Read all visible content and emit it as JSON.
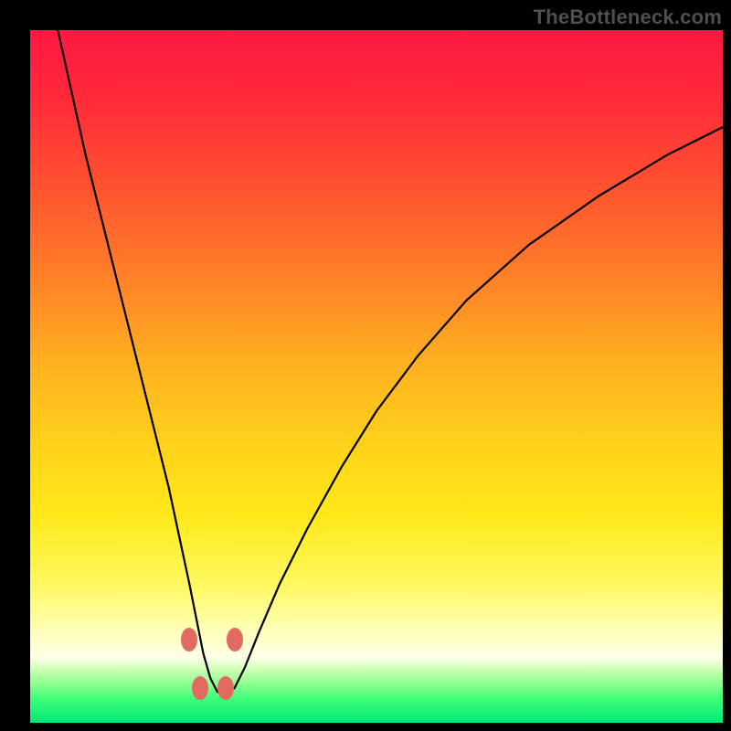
{
  "watermark": "TheBottleneck.com",
  "colors": {
    "page_bg": "#000000",
    "watermark": "#4f4f4f",
    "curve": "#000000",
    "dot": "#e26a60",
    "gradient_stops": [
      {
        "offset": 0.0,
        "color": "#ff1840"
      },
      {
        "offset": 0.1,
        "color": "#ff2a3a"
      },
      {
        "offset": 0.22,
        "color": "#ff5030"
      },
      {
        "offset": 0.35,
        "color": "#ff7e28"
      },
      {
        "offset": 0.48,
        "color": "#ffb020"
      },
      {
        "offset": 0.6,
        "color": "#ffd21a"
      },
      {
        "offset": 0.7,
        "color": "#ffe81a"
      },
      {
        "offset": 0.8,
        "color": "#fff860"
      },
      {
        "offset": 0.86,
        "color": "#ffffb0"
      },
      {
        "offset": 0.905,
        "color": "#ffffe8"
      },
      {
        "offset": 0.925,
        "color": "#c8ffb0"
      },
      {
        "offset": 0.945,
        "color": "#8aff90"
      },
      {
        "offset": 0.965,
        "color": "#40ff78"
      },
      {
        "offset": 1.0,
        "color": "#00e878"
      }
    ]
  },
  "chart_data": {
    "type": "line",
    "title": "",
    "xlabel": "",
    "ylabel": "",
    "xlim": [
      0,
      100
    ],
    "ylim": [
      0,
      100
    ],
    "grid": false,
    "legend": false,
    "series": [
      {
        "name": "bottleneck-curve",
        "x": [
          4,
          6,
          8,
          10,
          12,
          14,
          16,
          18,
          20,
          21.5,
          23,
          24.2,
          25,
          26,
          27,
          28,
          29.5,
          31,
          33,
          36,
          40,
          45,
          50,
          56,
          63,
          72,
          82,
          92,
          100
        ],
        "y": [
          100,
          91,
          82,
          74,
          66,
          58,
          50,
          42,
          34,
          27,
          20,
          14,
          10,
          6.5,
          4.5,
          4,
          5,
          8,
          13,
          20,
          28,
          37,
          45,
          53,
          61,
          69,
          76,
          82,
          86
        ]
      }
    ],
    "markers": [
      {
        "x": 23.0,
        "y": 12.0
      },
      {
        "x": 29.5,
        "y": 12.0
      },
      {
        "x": 24.5,
        "y": 5.0
      },
      {
        "x": 28.2,
        "y": 5.0
      }
    ]
  }
}
